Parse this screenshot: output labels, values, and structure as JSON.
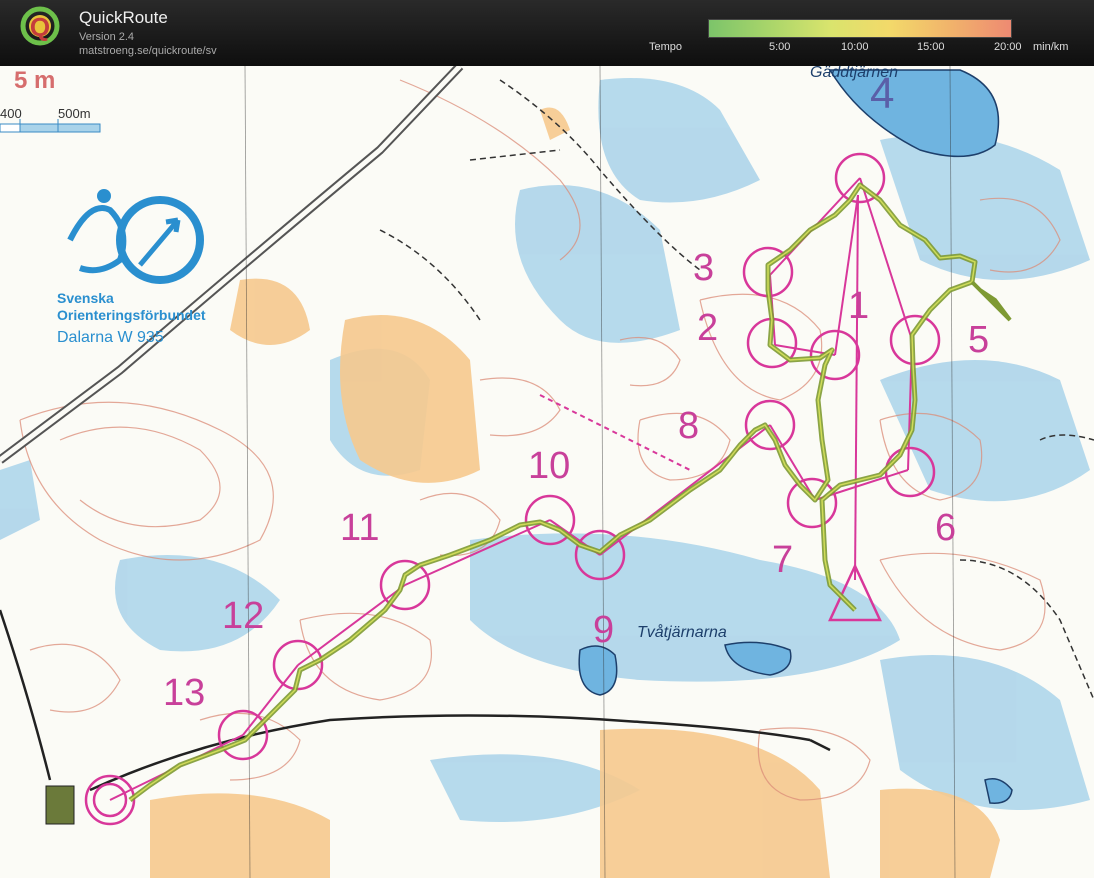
{
  "app": {
    "title": "QuickRoute",
    "version": "Version 2.4",
    "url": "matstroeng.se/quickroute/sv"
  },
  "tempo": {
    "label": "Tempo",
    "unit": "min/km",
    "ticks": [
      "5:00",
      "10:00",
      "15:00",
      "20:00"
    ]
  },
  "map": {
    "contour_interval": "5 m",
    "scale": {
      "left": "400",
      "right": "500m"
    },
    "federation": {
      "line1": "Svenska",
      "line2": "Orienteringsförbundet",
      "line3": "Dalarna  W 935"
    },
    "place_names": {
      "lake_north": "Gäddtjärnen",
      "lake_south": "Tvåtjärnarna"
    },
    "controls": [
      "1",
      "2",
      "3",
      "4",
      "5",
      "6",
      "7",
      "8",
      "9",
      "10",
      "11",
      "12",
      "13"
    ],
    "colors": {
      "course": "#d8379a",
      "route": "#8ba33a",
      "water": "#a7d4ec",
      "open": "#f4c78a",
      "contour": "#d98a6a"
    }
  }
}
